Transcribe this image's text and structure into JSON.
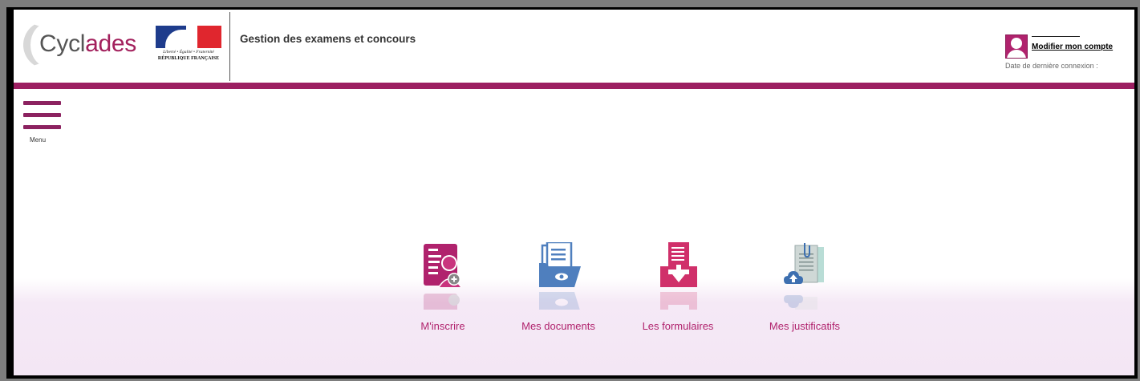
{
  "header": {
    "logo_text_part1": "Cycl",
    "logo_text_part2": "ades",
    "motto": "Liberté • Égalité • Fraternité",
    "republique": "RÉPUBLIQUE FRANÇAISE",
    "app_title": "Gestion des examens et concours",
    "account_link": "Modifier mon compte",
    "last_login_label": "Date de dernière connexion :"
  },
  "menu": {
    "label": "Menu"
  },
  "tiles": [
    {
      "label": "M'inscrire",
      "icon": "register-user-icon"
    },
    {
      "label": "Mes documents",
      "icon": "documents-folder-icon"
    },
    {
      "label": "Les formulaires",
      "icon": "forms-download-icon"
    },
    {
      "label": "Mes justificatifs",
      "icon": "receipts-upload-icon"
    }
  ],
  "colors": {
    "brand_purple": "#9c1f61",
    "tile_text": "#b0226d",
    "icon_magenta": "#b0226d",
    "icon_blue": "#4f7fbe",
    "icon_pink": "#d0306a",
    "icon_teal": "#9fc9c4"
  }
}
